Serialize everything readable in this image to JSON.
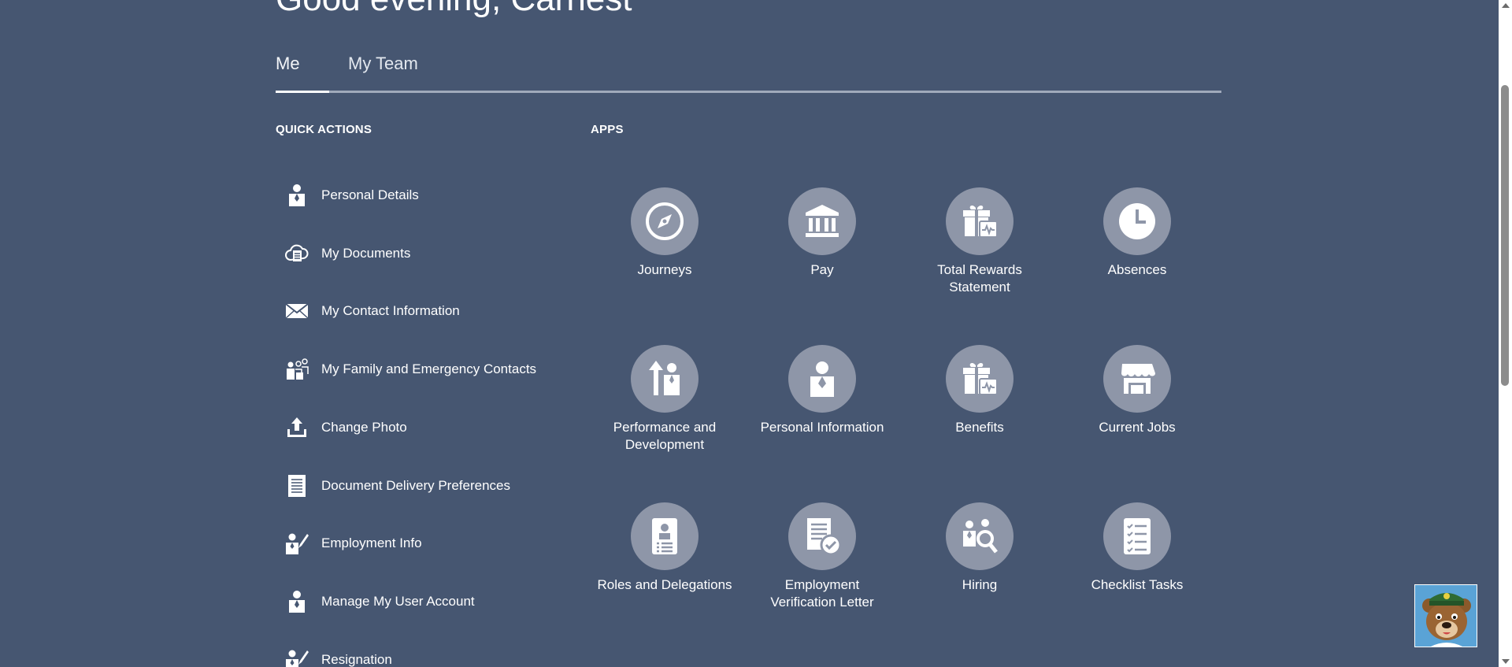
{
  "greeting": "Good evening, Carnest",
  "tabs": [
    {
      "label": "Me"
    },
    {
      "label": "My Team"
    }
  ],
  "quick_actions": {
    "title": "QUICK ACTIONS",
    "items": [
      {
        "label": "Personal Details",
        "icon": "person-icon"
      },
      {
        "label": "My Documents",
        "icon": "cloud-document-icon"
      },
      {
        "label": "My Contact Information",
        "icon": "envelope-icon"
      },
      {
        "label": "My Family and Emergency Contacts",
        "icon": "family-icon"
      },
      {
        "label": "Change Photo",
        "icon": "upload-icon"
      },
      {
        "label": "Document Delivery Preferences",
        "icon": "document-icon"
      },
      {
        "label": "Employment Info",
        "icon": "person-edit-icon"
      },
      {
        "label": "Manage My User Account",
        "icon": "person-icon"
      },
      {
        "label": "Resignation",
        "icon": "person-edit-icon"
      }
    ]
  },
  "apps": {
    "title": "APPS",
    "items": [
      {
        "label": "Journeys",
        "icon": "compass-icon"
      },
      {
        "label": "Pay",
        "icon": "bank-icon"
      },
      {
        "label": "Total Rewards Statement",
        "icon": "gift-chart-icon"
      },
      {
        "label": "Absences",
        "icon": "clock-icon"
      },
      {
        "label": "Performance and Development",
        "icon": "growth-person-icon"
      },
      {
        "label": "Personal Information",
        "icon": "person-icon"
      },
      {
        "label": "Benefits",
        "icon": "gift-chart-icon"
      },
      {
        "label": "Current Jobs",
        "icon": "store-icon"
      },
      {
        "label": "Roles and Delegations",
        "icon": "badge-icon"
      },
      {
        "label": "Employment Verification Letter",
        "icon": "document-check-icon"
      },
      {
        "label": "Hiring",
        "icon": "people-search-icon"
      },
      {
        "label": "Checklist Tasks",
        "icon": "checklist-icon"
      }
    ]
  },
  "colors": {
    "background": "#465671",
    "app_circle": "#8e96a8",
    "text": "#ffffff"
  }
}
